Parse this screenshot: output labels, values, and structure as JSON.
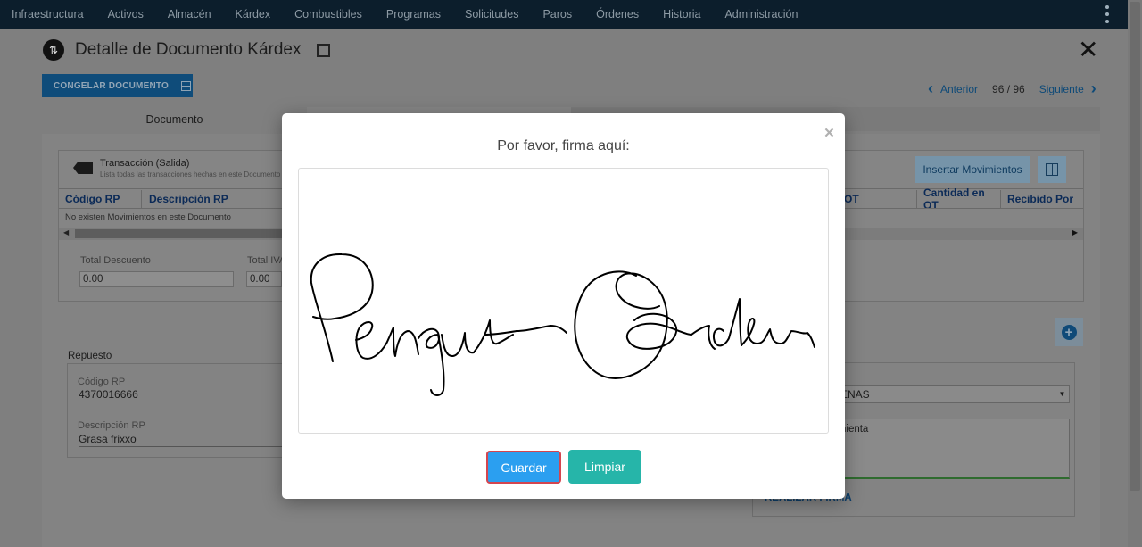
{
  "nav": {
    "items": [
      "Infraestructura",
      "Activos",
      "Almacén",
      "Kárdex",
      "Combustibles",
      "Programas",
      "Solicitudes",
      "Paros",
      "Órdenes",
      "Historia",
      "Administración"
    ]
  },
  "page": {
    "title": "Detalle de Documento Kárdex",
    "freeze_button": "CONGELAR DOCUMENTO",
    "pager": {
      "prev": "Anterior",
      "count": "96 / 96",
      "next": "Siguiente"
    },
    "tab_document": "Documento"
  },
  "transaction": {
    "title": "Transacción (Salida)",
    "subtitle": "Lista todas las transacciones hechas en este Documento",
    "insert_button": "Insertar Movimientos",
    "columns_left": [
      "Código RP",
      "Descripción RP"
    ],
    "columns_right": [
      "OT",
      "Cantidad en OT",
      "Recibido Por"
    ],
    "empty_message": "No existen Movimientos en este Documento",
    "total_discount_label": "Total Descuento",
    "total_discount_value": "0.00",
    "total_iva_label": "Total IVA",
    "total_iva_value": "0.00"
  },
  "repuesto": {
    "section_title": "Repuesto",
    "code_label": "Código RP",
    "code_value": "4370016666",
    "desc_label": "Descripción RP",
    "desc_value": "Grasa frixxo"
  },
  "right_form": {
    "select_value": "ENAS",
    "textarea_value": "nienta",
    "sign_link": "REALIZAR FIRMA"
  },
  "modal": {
    "title": "Por favor, firma aquí:",
    "close_symbol": "×",
    "save_button": "Guardar",
    "clear_button": "Limpiar"
  },
  "colors": {
    "nav_bg": "#0c1e2c",
    "save_button": "#2b9ff0",
    "save_border": "#d4454f",
    "clear_button": "#26b5a9"
  }
}
